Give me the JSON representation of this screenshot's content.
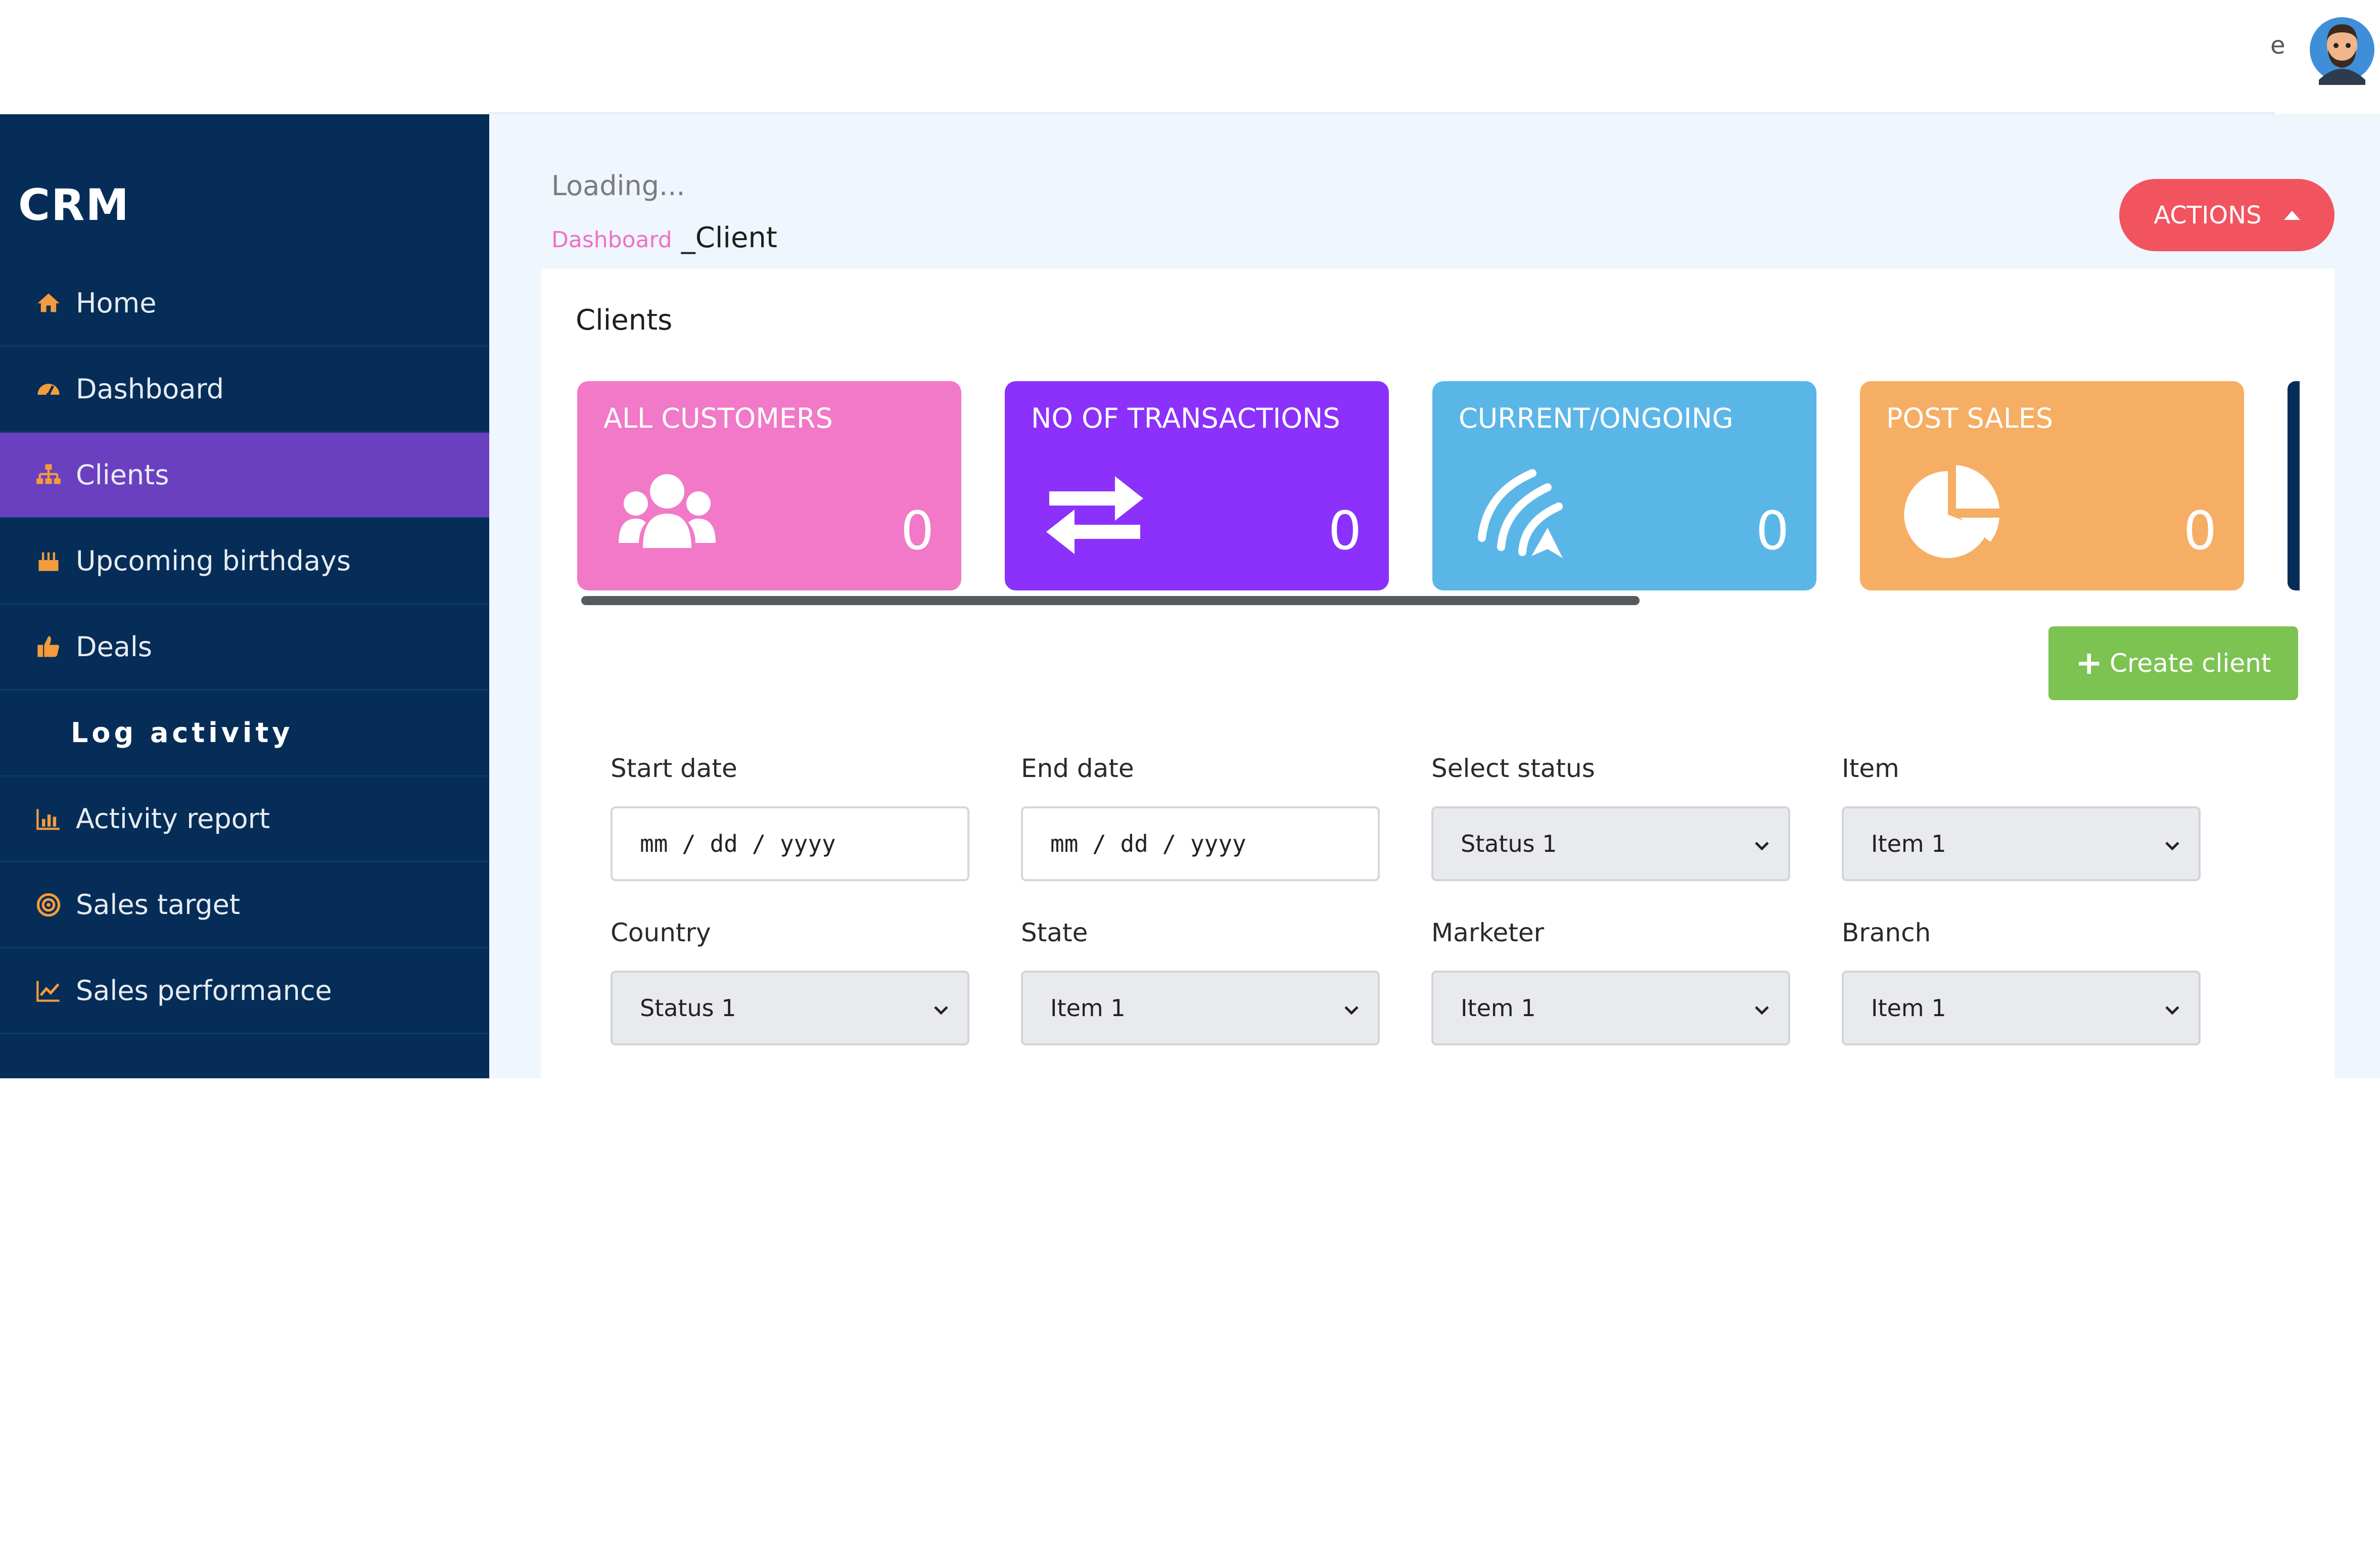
{
  "topbar": {
    "edge_text": "e",
    "avatar": "user-avatar"
  },
  "sidebar": {
    "brand": "CRM",
    "items": [
      {
        "label": "Home",
        "icon": "home-icon",
        "active": false
      },
      {
        "label": "Dashboard",
        "icon": "gauge-icon",
        "active": false
      },
      {
        "label": "Clients",
        "icon": "sitemap-icon",
        "active": true
      },
      {
        "label": "Upcoming birthdays",
        "icon": "cake-icon",
        "active": false
      },
      {
        "label": "Deals",
        "icon": "thumbs-up-icon",
        "active": false
      },
      {
        "label": "Log activity",
        "icon": "",
        "active": false
      },
      {
        "label": "Activity report",
        "icon": "bar-chart-icon",
        "active": false
      },
      {
        "label": "Sales target",
        "icon": "target-icon",
        "active": false
      },
      {
        "label": "Sales performance",
        "icon": "line-chart-icon",
        "active": false
      }
    ]
  },
  "header": {
    "loading_text": "Loading...",
    "breadcrumb": {
      "link": "Dashboard",
      "current": "Client"
    },
    "actions_label": "ACTIONS"
  },
  "panel": {
    "title": "Clients",
    "stats": [
      {
        "label": "ALL CUSTOMERS",
        "value": "0",
        "icon": "users-icon",
        "color": "#f179c7"
      },
      {
        "label": "NO OF TRANSACTIONS",
        "value": "0",
        "icon": "exchange-arrows-icon",
        "color": "#8b31fb"
      },
      {
        "label": "CURRENT/ONGOING",
        "value": "0",
        "icon": "signal-wave-icon",
        "color": "#5bb6e8"
      },
      {
        "label": "POST SALES",
        "value": "0",
        "icon": "pie-chart-icon",
        "color": "#f6ad64"
      }
    ],
    "create_label": "Create client"
  },
  "filters": {
    "start_date": {
      "label": "Start date",
      "placeholder": "mm / dd / yyyy"
    },
    "end_date": {
      "label": "End date",
      "placeholder": "mm / dd / yyyy"
    },
    "status": {
      "label": "Select status",
      "value": "Status 1"
    },
    "item": {
      "label": "Item",
      "value": "Item 1"
    },
    "country": {
      "label": "Country",
      "value": "Status 1"
    },
    "state": {
      "label": "State",
      "value": "Item 1"
    },
    "marketer": {
      "label": "Marketer",
      "value": "Item 1"
    },
    "branch": {
      "label": "Branch",
      "value": "Item 1"
    }
  },
  "colors": {
    "sidebar_bg": "#052d57",
    "active_item": "#6a40c0",
    "nav_icon": "#f39c3d",
    "actions_button": "#f2545f",
    "create_button": "#7cc352",
    "breadcrumb_link": "#f06fc6",
    "content_bg": "#eff6fd"
  }
}
